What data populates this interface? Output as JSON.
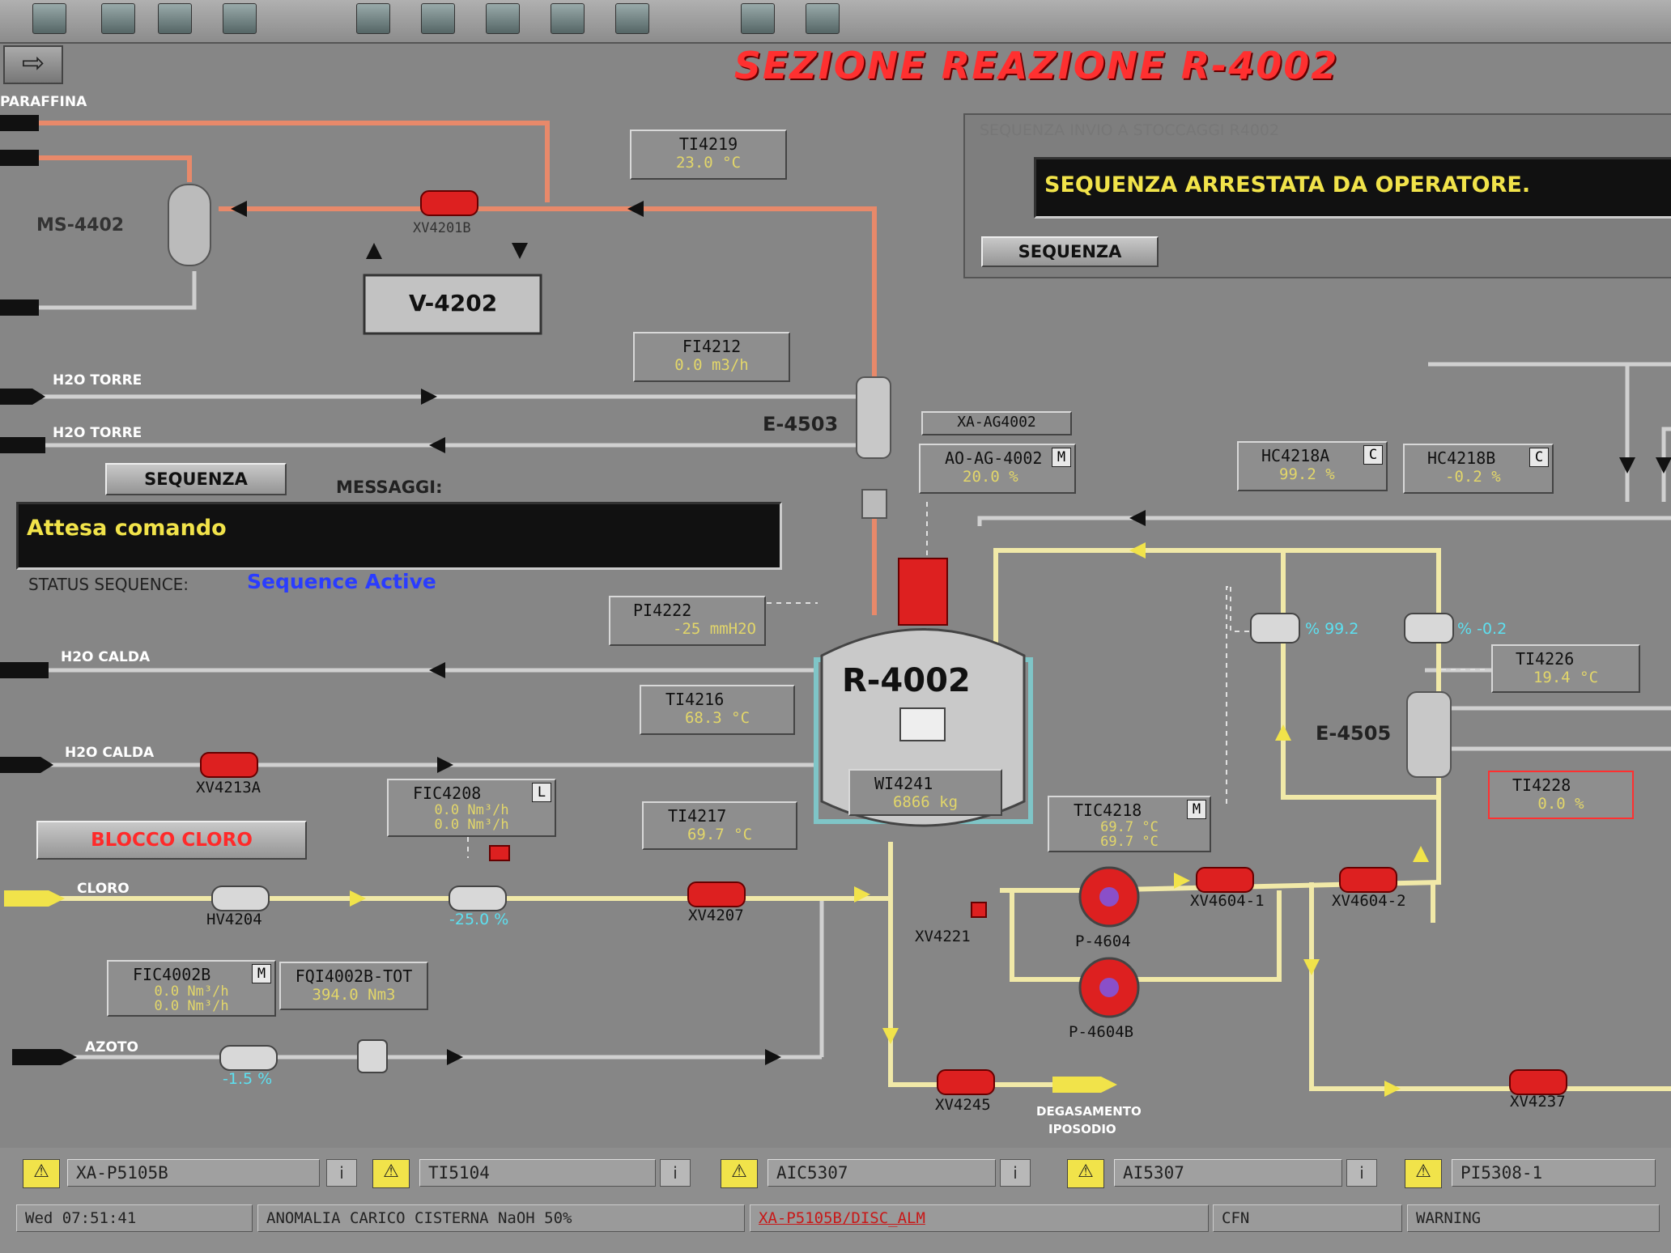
{
  "title": "SEZIONE REAZIONE R-4002",
  "sequence_panel": {
    "title": "SEQUENZA INVIO A STOCCAGGI R4002",
    "message": "SEQUENZA ARRESTATA DA OPERATORE.",
    "button": "SEQUENZA"
  },
  "left_sequence": {
    "button": "SEQUENZA",
    "messages_label": "MESSAGGI:",
    "message": "Attesa comando",
    "status_label": "STATUS SEQUENCE:",
    "status_value": "Sequence Active",
    "interlock_button": "BLOCCO CLORO"
  },
  "streams": {
    "paraffina": "PARAFFINA",
    "h2o_torre_1": "H2O TORRE",
    "h2o_torre_2": "H2O TORRE",
    "h2o_calda_1": "H2O CALDA",
    "h2o_calda_2": "H2O CALDA",
    "cloro": "CLORO",
    "azoto": "AZOTO",
    "degasamento_1": "DEGASAMENTO",
    "degasamento_2": "IPOSODIO"
  },
  "equipment": {
    "ms": "MS-4402",
    "v": "V-4202",
    "e4503": "E-4503",
    "reactor": "R-4002",
    "e4505": "E-4505",
    "p4604": "P-4604",
    "p4604b": "P-4604B"
  },
  "tags": {
    "ti4219": {
      "name": "TI4219",
      "value": "23.0 °C"
    },
    "fi4212": {
      "name": "FI4212",
      "value": "0.0 m3/h"
    },
    "xa_ag4002": {
      "name": "XA-AG4002"
    },
    "ao_ag4002": {
      "name": "AO-AG-4002",
      "mode": "M",
      "value": "20.0 %"
    },
    "hc4218a": {
      "name": "HC4218A",
      "mode": "C",
      "value": "99.2 %"
    },
    "hc4218b": {
      "name": "HC4218B",
      "mode": "C",
      "value": "-0.2 %"
    },
    "pi4222": {
      "name": "PI4222",
      "value": "-25 mmH2O"
    },
    "ti4216": {
      "name": "TI4216",
      "value": "68.3 °C"
    },
    "ti4226": {
      "name": "TI4226",
      "value": "19.4 °C"
    },
    "wi4241": {
      "name": "WI4241",
      "value": "6866 kg"
    },
    "fic4208": {
      "name": "FIC4208",
      "mode": "L",
      "value1": "0.0 Nm³/h",
      "value2": "0.0 Nm³/h"
    },
    "ti4217": {
      "name": "TI4217",
      "value": "69.7 °C"
    },
    "tic4218": {
      "name": "TIC4218",
      "mode": "M",
      "value1": "69.7 °C",
      "value2": "69.7 °C"
    },
    "ti4228": {
      "name": "TI4228",
      "value": "0.0 %"
    },
    "fic4002b": {
      "name": "FIC4002B",
      "mode": "M",
      "value1": "0.0 Nm³/h",
      "value2": "0.0 Nm³/h"
    },
    "fqi4002b": {
      "name": "FQI4002B-TOT",
      "value": "394.0 Nm3"
    }
  },
  "valves": {
    "xv4201b": "XV4201B",
    "xv4213a": "XV4213A",
    "hv4204": "HV4204",
    "xv4207": "XV4207",
    "xv4221": "XV4221",
    "xv4604_1": "XV4604-1",
    "xv4604_2": "XV4604-2",
    "xv4245": "XV4245",
    "xv4237": "XV4237"
  },
  "valve_positions": {
    "fcv4208": "-25.0 %",
    "azoto": "-1.5 %",
    "hc_a": "% 99.2",
    "hc_b": "% -0.2"
  },
  "alarm_bar": {
    "alarms": [
      {
        "tag": "XA-P5105B",
        "info": "i"
      },
      {
        "tag": "TI5104",
        "info": "i"
      },
      {
        "tag": "AIC5307",
        "info": "i"
      },
      {
        "tag": "AI5307",
        "info": "i"
      },
      {
        "tag": "PI5308-1"
      }
    ],
    "datetime": "Wed 07:51:41",
    "message": "ANOMALIA CARICO CISTERNA NaOH 50%",
    "source": "XA-P5105B/DISC_ALM",
    "area": "CFN",
    "severity": "WARNING"
  },
  "colors": {
    "background": "#868686",
    "title": "#ff3030",
    "value": "#e2d66a",
    "status_active": "#2a3cff",
    "pipe_paraffin": "#e8896a",
    "pipe_chlorine": "#f1e9a8",
    "valve": "#dd2020"
  }
}
